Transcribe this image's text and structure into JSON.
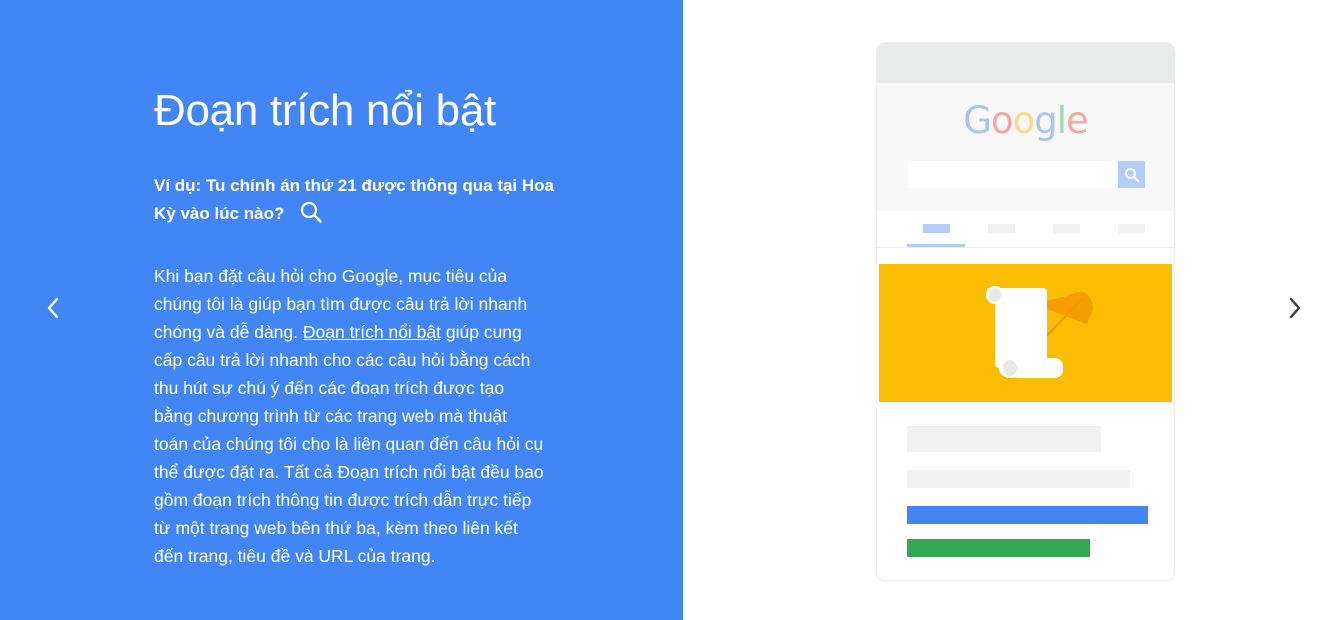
{
  "left": {
    "title": "Đoạn trích nổi bật",
    "question": "Ví dụ: Tu chính án thứ 21 được thông qua tại Hoa Kỳ vào lúc nào?",
    "question_icon": "search-icon",
    "body_before_link": "Khi bạn đặt câu hỏi cho Google, mục tiêu của chúng tôi là giúp bạn tìm được câu trả lời nhanh chóng và dễ dàng. ",
    "body_link": "Đoạn trích nổi bật",
    "body_after_link": " giúp cung cấp câu trả lời nhanh cho các câu hỏi bằng cách thu hút sự chú ý đến các đoạn trích được tạo bằng chương trình từ các trang web mà thuật toán của chúng tôi cho là liên quan đến câu hỏi cụ thể được đặt ra. Tất cả Đoạn trích nổi bật đều bao gồm đoạn trích thông tin được trích dẫn trực tiếp từ một trang web bên thứ ba, kèm theo liên kết đến trang, tiêu đề và URL của trang."
  },
  "nav": {
    "prev_icon": "chevron-left-icon",
    "next_icon": "chevron-right-icon"
  },
  "illustration": {
    "logo_letters": [
      "G",
      "o",
      "o",
      "g",
      "l",
      "e"
    ],
    "snippet_icons": [
      "scroll-icon",
      "feather-quill-icon"
    ]
  },
  "colors": {
    "panel_blue": "#4285f4",
    "snippet_yellow": "#fbbc04",
    "result_blue": "#4285f4",
    "result_green": "#34a853",
    "placeholder_gray": "#f1f1f1"
  }
}
